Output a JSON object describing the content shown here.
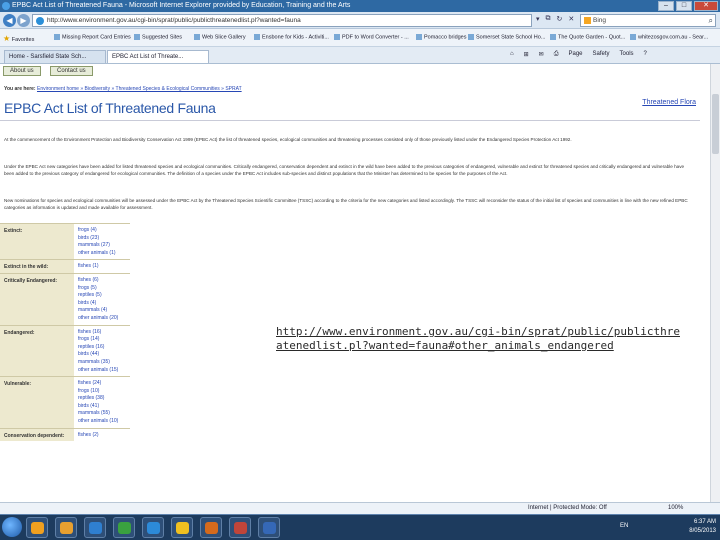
{
  "window": {
    "title": "EPBC Act List of Threatened Fauna - Microsoft Internet Explorer provided by Education, Training and the Arts",
    "minimize": "–",
    "maximize": "□",
    "close": "✕"
  },
  "addressbar": {
    "url": "http://www.environment.gov.au/cgi-bin/sprat/public/publicthreatenedlist.pl?wanted=fauna",
    "search_engine": "Bing"
  },
  "favorites": [
    "Favorites",
    "Missing Report Card Entries",
    "Suggested Sites",
    "Web Slice Gallery",
    "Ensbone for Kids - Activiti...",
    "PDF to Word Converter - ...",
    "Pomacco bridges",
    "Somerset State School Ho...",
    "The Quote Garden - Quot...",
    "whitezosgov.com.au - Sear..."
  ],
  "tabs": [
    {
      "label": "Home - Sarsfield State Sch..."
    },
    {
      "label": "EPBC Act List of Threate..."
    }
  ],
  "commandbar": [
    "Page",
    "Safety",
    "Tools"
  ],
  "site_menu": [
    "About us",
    "Contact us"
  ],
  "breadcrumb": {
    "prefix": "You are here:",
    "trail": "Environment home » Biodiversity » Threatened Species & Ecological Communities » SPRAT"
  },
  "page": {
    "title": "EPBC Act List of Threatened Fauna",
    "top_link": "Threatened Flora",
    "paragraphs": [
      "At the commencement of the Environment Protection and Biodiversity Conservation Act 1999 (EPBC Act) the list of threatened species, ecological communities and threatening processes consisted only of those previously listed under the Endangered Species Protection Act 1992.",
      "Under the EPBC Act new categories have been added for listed threatened species and ecological communities. Critically endangered, conservation dependent and extinct in the wild have been added to the previous categories of endangered, vulnerable and extinct for threatened species and critically endangered and vulnerable have been added to the previous category of endangered for ecological communities. The definition of a species under the EPBC Act includes sub-species and distinct populations that the Minister has determined to be species for the purposes of the Act.",
      "New nominations for species and ecological communities will be assessed under the EPBC Act by the Threatened Species Scientific Committee (TSSC) according to the criteria for the new categories and listed accordingly. The TSSC will reconsider the status of the initial list of species and communities in line with the new refined EPBC categories as information is updated and made available for assessment."
    ]
  },
  "fauna_table": [
    {
      "category": "Extinct:",
      "links": [
        "frogs (4)",
        "birds (23)",
        "mammals (27)",
        "other animals (1)"
      ]
    },
    {
      "category": "Extinct in the wild:",
      "links": [
        "fishes (1)"
      ]
    },
    {
      "category": "Critically Endangered:",
      "links": [
        "fishes (6)",
        "frogs (5)",
        "reptiles (5)",
        "birds (4)",
        "mammals (4)",
        "other animals (20)"
      ]
    },
    {
      "category": "Endangered:",
      "links": [
        "fishes (16)",
        "frogs (14)",
        "reptiles (16)",
        "birds (44)",
        "mammals (35)",
        "other animals (15)"
      ]
    },
    {
      "category": "Vulnerable:",
      "links": [
        "fishes (24)",
        "frogs (10)",
        "reptiles (38)",
        "birds (41)",
        "mammals (55)",
        "other animals (10)"
      ]
    },
    {
      "category": "Conservation dependent:",
      "links": [
        "fishes (2)"
      ]
    }
  ],
  "overlay": {
    "url_text": "http://www.environment.gov.au/cgi-bin/sprat/public/publicthreatenedlist.pl?wanted=fauna#other_animals_endangered"
  },
  "statusbar": {
    "zone": "Internet | Protected Mode: Off",
    "zoom": "100%"
  },
  "taskbar": {
    "language": "EN",
    "time": "6:37 AM",
    "date": "8/05/2013"
  },
  "taskbar_icon_colors": [
    "#f0a020",
    "#e8a030",
    "#2f7fd0",
    "#3aa140",
    "#2c8ad8",
    "#f0c020",
    "#d56a1c",
    "#c0453a",
    "#3568b7"
  ]
}
